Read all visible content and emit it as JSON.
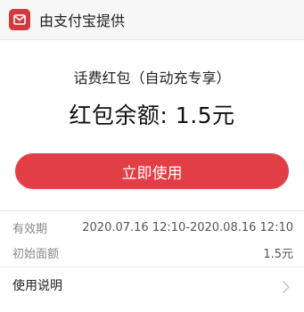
{
  "header": {
    "provider_text": "由支付宝提供",
    "logo_icon": "red-envelope-icon",
    "logo_color": "#d33a3f"
  },
  "coupon": {
    "subtitle": "话费红包（自动充专享）",
    "balance": "红包余额: 1.5元"
  },
  "actions": {
    "use_button_label": "立即使用",
    "button_color": "#e13f45"
  },
  "details": {
    "validity_label": "有效期",
    "validity_value": "2020.07.16 12:10-2020.08.16 12:10",
    "initial_label": "初始面额",
    "initial_value": "1.5元",
    "usage_label": "使用说明",
    "usage_icon": "chevron-right-icon"
  }
}
